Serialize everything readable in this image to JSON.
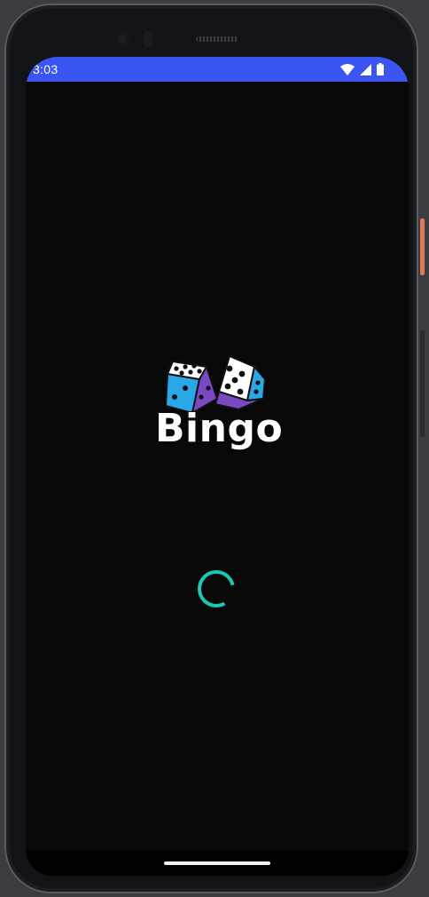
{
  "status_bar": {
    "time": "3:03",
    "icons": [
      "wifi-icon",
      "cellular-signal-icon",
      "battery-icon"
    ],
    "color": "#3a55f2"
  },
  "splash": {
    "app_name": "Bingo",
    "logo_icon": "dice-icon",
    "loading_indicator": "spinner",
    "background": "#080809",
    "accent": "#1cc7b8"
  },
  "dice_colors": {
    "blue": "#2aa7e6",
    "purple": "#7a48c2"
  },
  "nav_bar": {
    "indicator": "home-indicator"
  }
}
